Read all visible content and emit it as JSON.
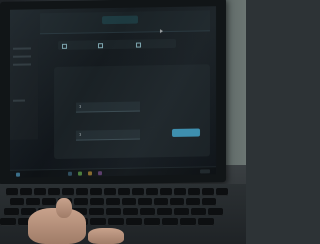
{
  "scene": {
    "description_type": "photo",
    "colors": {
      "screen_bg": "#10151a",
      "accent": "#3b8fb0",
      "skin": "#c8a28c"
    }
  },
  "screen": {
    "options": [
      {
        "label": "",
        "checked": true
      },
      {
        "label": "",
        "checked": false
      },
      {
        "label": "",
        "checked": true
      }
    ],
    "fields": [
      {
        "label": "",
        "value": "1"
      },
      {
        "label": "",
        "value": "1"
      }
    ]
  },
  "icons": {
    "cursor": "pointer-icon",
    "taskbar": [
      "start-icon",
      "search-icon",
      "browser-icon",
      "folder-icon",
      "app-icon"
    ]
  }
}
